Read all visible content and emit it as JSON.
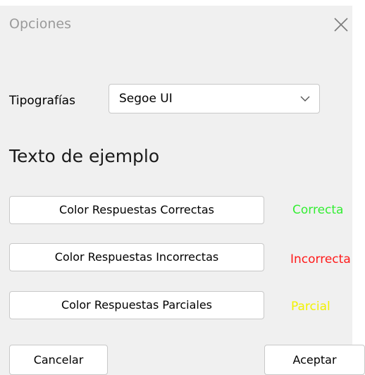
{
  "dialog": {
    "title": "Opciones",
    "close_icon": "close-icon"
  },
  "font_setting": {
    "label": "Tipografías",
    "selected": "Segoe UI",
    "chevron_icon": "chevron-down-icon"
  },
  "sample_text": "Texto de ejemplo",
  "color_rows": [
    {
      "button_label": "Color Respuestas Correctas",
      "sample": "Correcta",
      "color": "#33ee33"
    },
    {
      "button_label": "Color Respuestas Incorrectas",
      "sample": "Incorrecta",
      "color": "#ff1a1a"
    },
    {
      "button_label": "Color Respuestas Parciales",
      "sample": "Parcial",
      "color": "#f2f200"
    }
  ],
  "footer": {
    "cancel_label": "Cancelar",
    "accept_label": "Aceptar"
  }
}
